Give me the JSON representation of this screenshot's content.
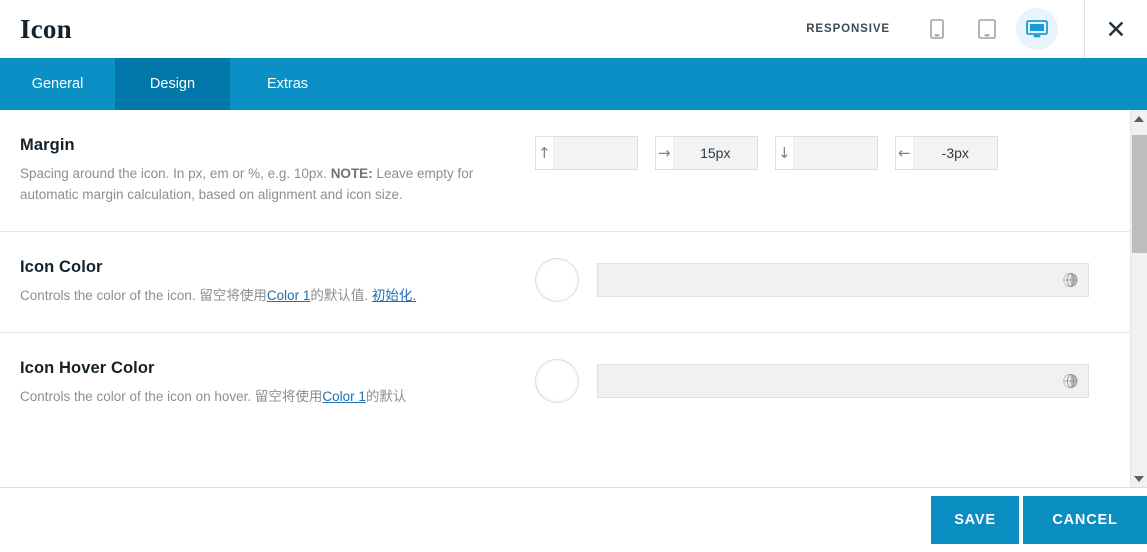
{
  "header": {
    "title": "Icon",
    "responsive_label": "RESPONSIVE",
    "devices": [
      {
        "name": "mobile",
        "icon": "mobile-icon",
        "active": false
      },
      {
        "name": "tablet",
        "icon": "tablet-icon",
        "active": false
      },
      {
        "name": "desktop",
        "icon": "desktop-icon",
        "active": true
      }
    ],
    "close_label": "✕"
  },
  "tabs": [
    {
      "label": "General",
      "active": false
    },
    {
      "label": "Design",
      "active": true
    },
    {
      "label": "Extras",
      "active": false
    }
  ],
  "sections": {
    "margin": {
      "title": "Margin",
      "desc_part1": "Spacing around the icon. In px, em or %, e.g. 10px. ",
      "desc_note": "NOTE:",
      "desc_part2": " Leave empty for automatic margin calculation, based on alignment and icon size.",
      "inputs": [
        {
          "icon": "arrow-up-icon",
          "glyph": "↑",
          "value": "",
          "placeholder": ""
        },
        {
          "icon": "arrow-right-icon",
          "glyph": "→",
          "value": "15px",
          "placeholder": ""
        },
        {
          "icon": "arrow-down-icon",
          "glyph": "↓",
          "value": "",
          "placeholder": ""
        },
        {
          "icon": "arrow-left-icon",
          "glyph": "←",
          "value": "-3px",
          "placeholder": ""
        }
      ]
    },
    "icon_color": {
      "title": "Icon Color",
      "desc_part1": "Controls the color of the icon. 留空将使用",
      "link1": "Color 1",
      "desc_part2": "的默认值. ",
      "link2": "初始化.",
      "value": "",
      "placeholder": "",
      "swatch_color": "#ffffff"
    },
    "icon_hover_color": {
      "title": "Icon Hover Color",
      "desc_part1": "Controls the color of the icon on hover. 留空将使用",
      "link1": "Color 1",
      "desc_part2": "的默认",
      "value": "",
      "placeholder": "",
      "swatch_color": "#ffffff"
    }
  },
  "footer": {
    "save_label": "SAVE",
    "cancel_label": "CANCEL"
  },
  "colors": {
    "tab_bar": "#0a90c4",
    "tab_active": "#0077a8",
    "button": "#0a8ec2",
    "link": "#1f6fb2",
    "device_active_bg": "#e8f4fb"
  }
}
